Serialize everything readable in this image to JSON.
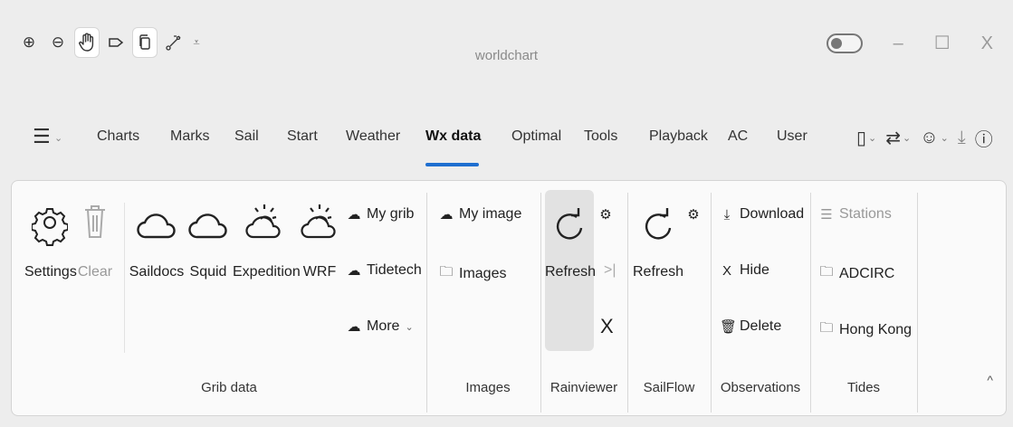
{
  "titlebar": {
    "title": "worldchart",
    "window_controls": {
      "minimize": "–",
      "maximize": "☐",
      "close": "X"
    }
  },
  "quick_access": [
    {
      "name": "zoom-in-icon",
      "glyph": "⊕"
    },
    {
      "name": "zoom-out-icon",
      "glyph": "⊖"
    },
    {
      "name": "pan-hand-icon",
      "glyph": "✋"
    },
    {
      "name": "tag-icon",
      "glyph": "⊳"
    },
    {
      "name": "copy-icon",
      "glyph": "⧉"
    },
    {
      "name": "route-icon",
      "glyph": "⟋"
    },
    {
      "name": "customize-chevron-icon",
      "glyph": "⩡"
    }
  ],
  "menu": {
    "tabs": [
      "Charts",
      "Marks",
      "Sail",
      "Start",
      "Weather",
      "Wx data",
      "Optimal",
      "Tools",
      "Playback",
      "AC",
      "User"
    ],
    "active_tab": "Wx data"
  },
  "ribbon": {
    "grib": {
      "label": "Grib data",
      "settings": "Settings",
      "clear": "Clear",
      "saildocs": "Saildocs",
      "squid": "Squid",
      "expedition": "Expedition",
      "wrf": "WRF",
      "my_grib": "My grib",
      "tidetech": "Tidetech",
      "more": "More"
    },
    "images": {
      "label": "Images",
      "my_image": "My image",
      "images": "Images"
    },
    "rainviewer": {
      "label": "Rainviewer",
      "refresh": "Refresh"
    },
    "sailflow": {
      "label": "SailFlow",
      "refresh": "Refresh"
    },
    "observations": {
      "label": "Observations",
      "download": "Download",
      "hide": "Hide",
      "delete": "Delete"
    },
    "tides": {
      "label": "Tides",
      "stations": "Stations",
      "adcirc": "ADCIRC",
      "hong_kong": "Hong Kong"
    }
  },
  "colors": {
    "accent": "#1f6fd0",
    "background": "#ededed",
    "ribbon": "#fafafa"
  }
}
